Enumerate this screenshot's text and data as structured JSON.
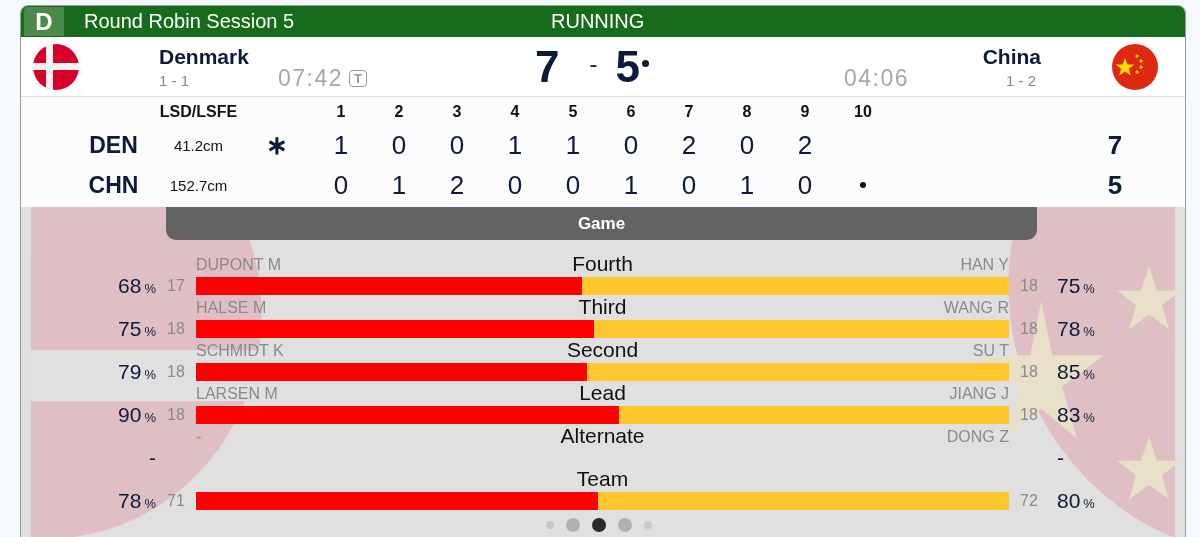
{
  "header": {
    "badge": "D",
    "title": "Round Robin Session 5",
    "status": "RUNNING"
  },
  "teams": [
    {
      "name": "Denmark",
      "record": "1 - 1",
      "clock": "07:42",
      "timeout": "T",
      "score": "7",
      "hammer": false
    },
    {
      "name": "China",
      "record": "1 - 2",
      "clock": "04:06",
      "score": "5",
      "hammer": true
    }
  ],
  "score_separator": "-",
  "linescore": {
    "columns": {
      "lsd": "LSD/LSFE",
      "ends": [
        "1",
        "2",
        "3",
        "4",
        "5",
        "6",
        "7",
        "8",
        "9",
        "10"
      ]
    },
    "rows": [
      {
        "team": "DEN",
        "lsd": "41.2cm",
        "first_hammer": "∗",
        "ends": [
          "1",
          "0",
          "0",
          "1",
          "1",
          "0",
          "2",
          "0",
          "2"
        ],
        "current_end_hammer": false,
        "total": "7"
      },
      {
        "team": "CHN",
        "lsd": "152.7cm",
        "first_hammer": "",
        "ends": [
          "0",
          "1",
          "2",
          "0",
          "0",
          "1",
          "0",
          "1",
          "0"
        ],
        "current_end_hammer": true,
        "total": "5"
      }
    ]
  },
  "game_tab": "Game",
  "positions": [
    {
      "position": "Fourth",
      "left": {
        "name": "DUPONT M",
        "count": "17",
        "percent": "68",
        "unit": "%"
      },
      "right": {
        "name": "HAN Y",
        "count": "18",
        "percent": "75",
        "unit": "%"
      },
      "level": 0.475
    },
    {
      "position": "Third",
      "left": {
        "name": "HALSE M",
        "count": "18",
        "percent": "75",
        "unit": "%"
      },
      "right": {
        "name": "WANG R",
        "count": "18",
        "percent": "78",
        "unit": "%"
      },
      "level": 0.49
    },
    {
      "position": "Second",
      "left": {
        "name": "SCHMIDT K",
        "count": "18",
        "percent": "79",
        "unit": "%"
      },
      "right": {
        "name": "SU T",
        "count": "18",
        "percent": "85",
        "unit": "%"
      },
      "level": 0.481
    },
    {
      "position": "Lead",
      "left": {
        "name": "LARSEN M",
        "count": "18",
        "percent": "90",
        "unit": "%"
      },
      "right": {
        "name": "JIANG J",
        "count": "18",
        "percent": "83",
        "unit": "%"
      },
      "level": 0.52
    },
    {
      "position": "Alternate",
      "left": {
        "name": "-",
        "percent": "-"
      },
      "right": {
        "name": "DONG Z",
        "percent": "-"
      }
    },
    {
      "position": "Team",
      "left": {
        "count": "71",
        "percent": "78",
        "unit": "%"
      },
      "right": {
        "count": "72",
        "percent": "80",
        "unit": "%"
      },
      "level": 0.494
    }
  ],
  "pages": [
    {
      "selected": false
    },
    {
      "selected": false
    },
    {
      "selected": true
    },
    {
      "selected": false
    },
    {
      "selected": false
    }
  ]
}
